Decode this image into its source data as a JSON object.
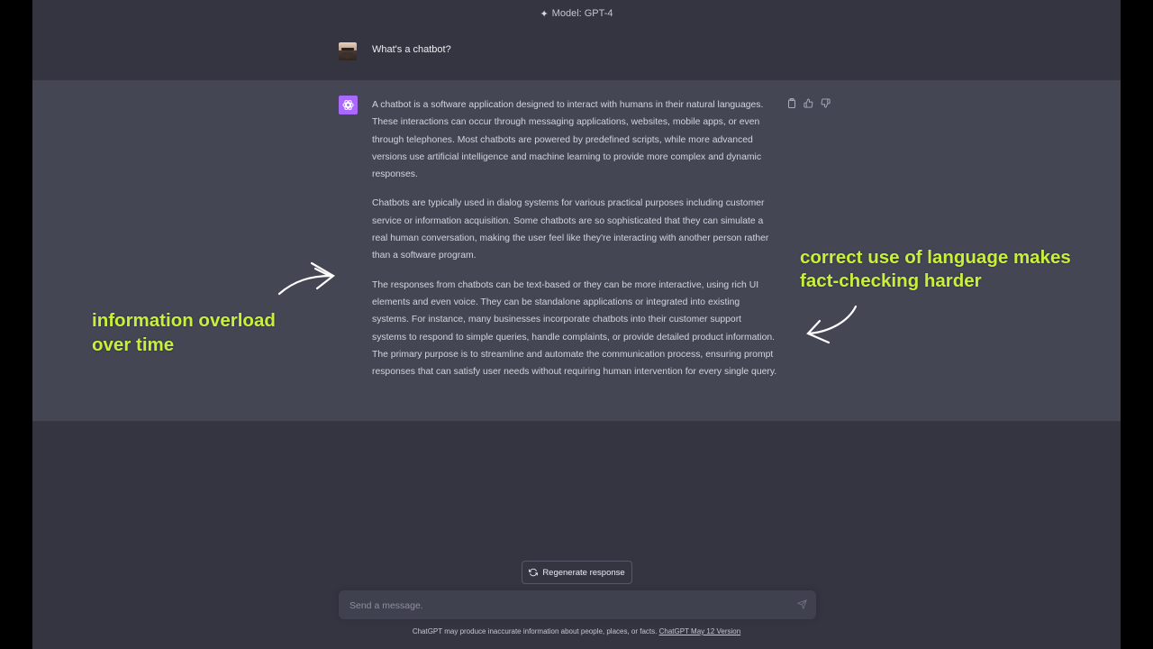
{
  "header": {
    "model_label": "Model: GPT-4",
    "model_icon": "sparkle-icon"
  },
  "conversation": {
    "user_message": "What's a chatbot?",
    "assistant_paragraphs": [
      "A chatbot is a software application designed to interact with humans in their natural languages. These interactions can occur through messaging applications, websites, mobile apps, or even through telephones. Most chatbots are powered by predefined scripts, while more advanced versions use artificial intelligence and machine learning to provide more complex and dynamic responses.",
      "Chatbots are typically used in dialog systems for various practical purposes including customer service or information acquisition. Some chatbots are so sophisticated that they can simulate a real human conversation, making the user feel like they're interacting with another person rather than a software program.",
      "The responses from chatbots can be text-based or they can be more interactive, using rich UI elements and even voice. They can be standalone applications or integrated into existing systems. For instance, many businesses incorporate chatbots into their customer support systems to respond to simple queries, handle complaints, or provide detailed product information. The primary purpose is to streamline and automate the communication process, ensuring prompt responses that can satisfy user needs without requiring human intervention for every single query."
    ],
    "actions": [
      "copy-icon",
      "thumbs-up-icon",
      "thumbs-down-icon"
    ]
  },
  "annotations": {
    "left_line1": "information overload",
    "left_line2": "over time",
    "right_line1": "correct use of language makes",
    "right_line2": "fact-checking harder",
    "color": "#c8f03a"
  },
  "composer": {
    "regenerate_label": "Regenerate response",
    "placeholder": "Send a message.",
    "footer_text": "ChatGPT may produce inaccurate information about people, places, or facts.",
    "footer_link": "ChatGPT May 12 Version"
  },
  "colors": {
    "background": "#343541",
    "assistant_row": "#444654",
    "assistant_avatar": "#ab68ff",
    "input": "#40414f"
  }
}
